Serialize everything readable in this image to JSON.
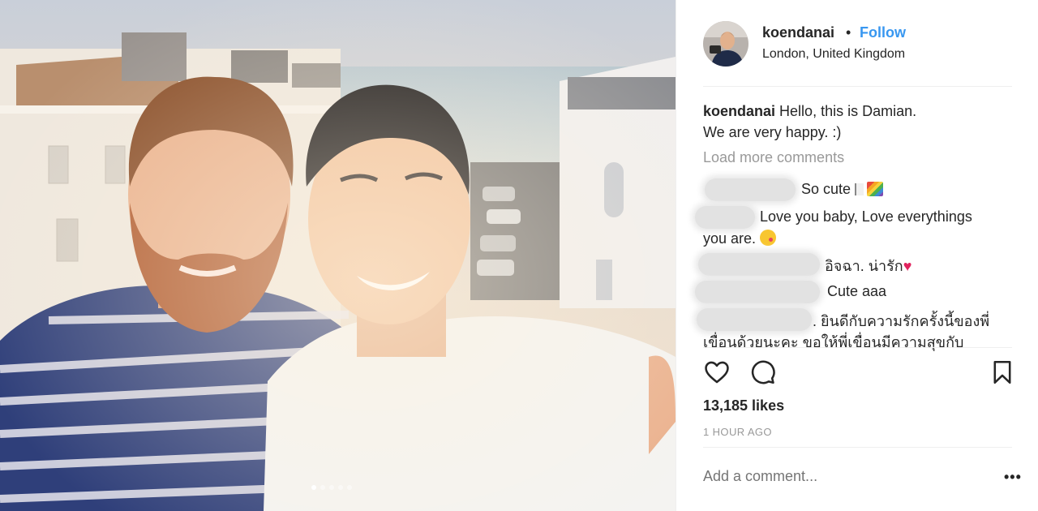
{
  "post": {
    "username": "koendanai",
    "separator": "•",
    "follow_label": "Follow",
    "location": "London, United Kingdom",
    "caption_user": "koendanai",
    "caption_line1": "Hello, this is Damian.",
    "caption_line2": "We are very happy. :)",
    "load_more": "Load more comments",
    "comments": [
      {
        "text": "So cute"
      },
      {
        "text_line1": "Love you baby, Love everythings",
        "text_line2": "you are."
      },
      {
        "text": "อิจฉา. น่ารัก"
      },
      {
        "text": "Cute aaa"
      },
      {
        "text_line1": ". ยินดีกับความรักครั้งนี้ของพี่",
        "text_line2": "เขื่อนด้วยนะคะ ขอให้พี่เขื่อนมีความสุขกับ"
      }
    ],
    "likes": "13,185 likes",
    "time": "1 HOUR AGO",
    "add_comment_placeholder": "Add a comment...",
    "more_label": "•••",
    "carousel": {
      "count": 5,
      "active": 1
    }
  },
  "colors": {
    "link": "#3897f0",
    "text": "#262626",
    "muted": "#999999",
    "divider": "#efefef"
  },
  "icons": [
    "heart-icon",
    "comment-icon",
    "bookmark-icon",
    "more-options-icon"
  ]
}
